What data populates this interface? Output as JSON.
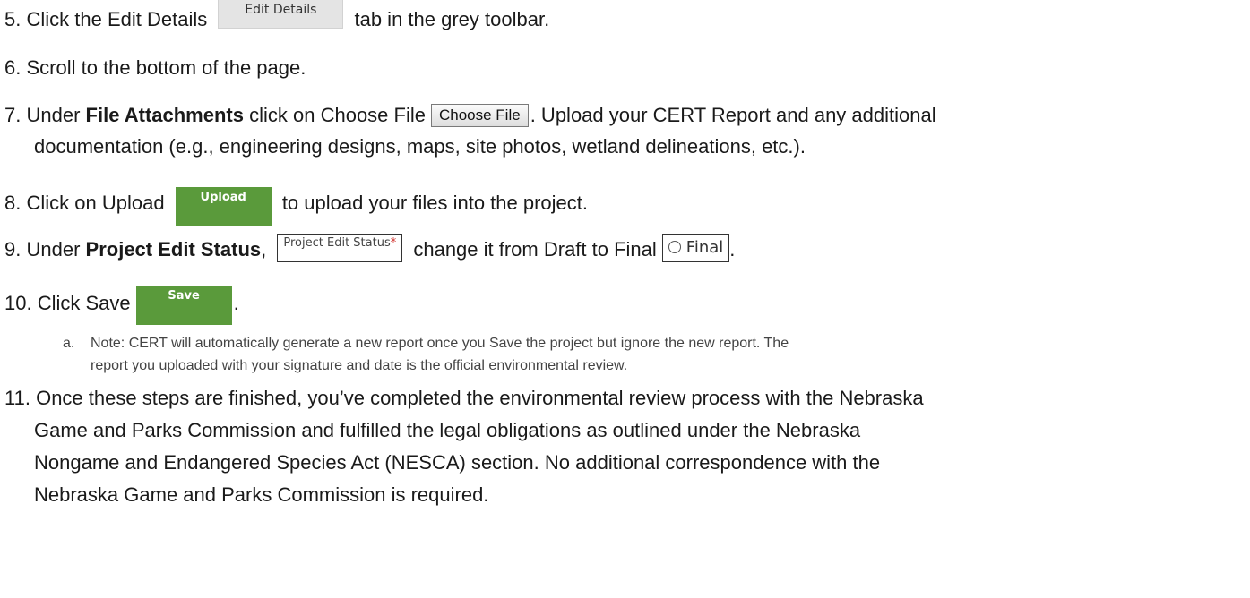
{
  "steps": [
    {
      "num": "5.",
      "before": "Click the Edit Details",
      "button": "Edit Details",
      "after": "tab in the grey toolbar."
    },
    {
      "num": "6.",
      "text": "Scroll to the bottom of the page."
    },
    {
      "num": "7.",
      "pre": "Under",
      "bold": "File Attachments",
      "mid": "click on Choose File",
      "button": "Choose File",
      "after": ". Upload your CERT Report and any additional",
      "cont": "documentation (e.g., engineering designs, maps, site photos, wetland delineations, etc.)."
    },
    {
      "num": "8.",
      "before": "Click on Upload",
      "button": "Upload",
      "after": "to upload your files into the project."
    },
    {
      "num": "9.",
      "pre": "Under",
      "bold": "Project Edit Status",
      "comma": ",",
      "field_label": "Project Edit Status",
      "field_req": "*",
      "mid": "change it from Draft to Final",
      "option": "Final",
      "after": "."
    },
    {
      "num": "10.",
      "before": "Click Save",
      "button": "Save",
      "after": "."
    },
    {
      "num": "11.",
      "line1": "Once these steps are finished, you’ve completed the environmental review process with the Nebraska",
      "line2": "Game and Parks Commission and fulfilled the legal obligations as outlined under the Nebraska",
      "line3": "Nongame and Endangered Species Act (NESCA) section. No additional correspondence with the",
      "line4": "Nebraska Game and Parks Commission is required."
    }
  ],
  "note": {
    "marker": "a.",
    "line1": "Note: CERT will automatically generate a new report once you Save the project but ignore the new report. The",
    "line2": "report you uploaded with your signature and date is the official environmental review."
  }
}
